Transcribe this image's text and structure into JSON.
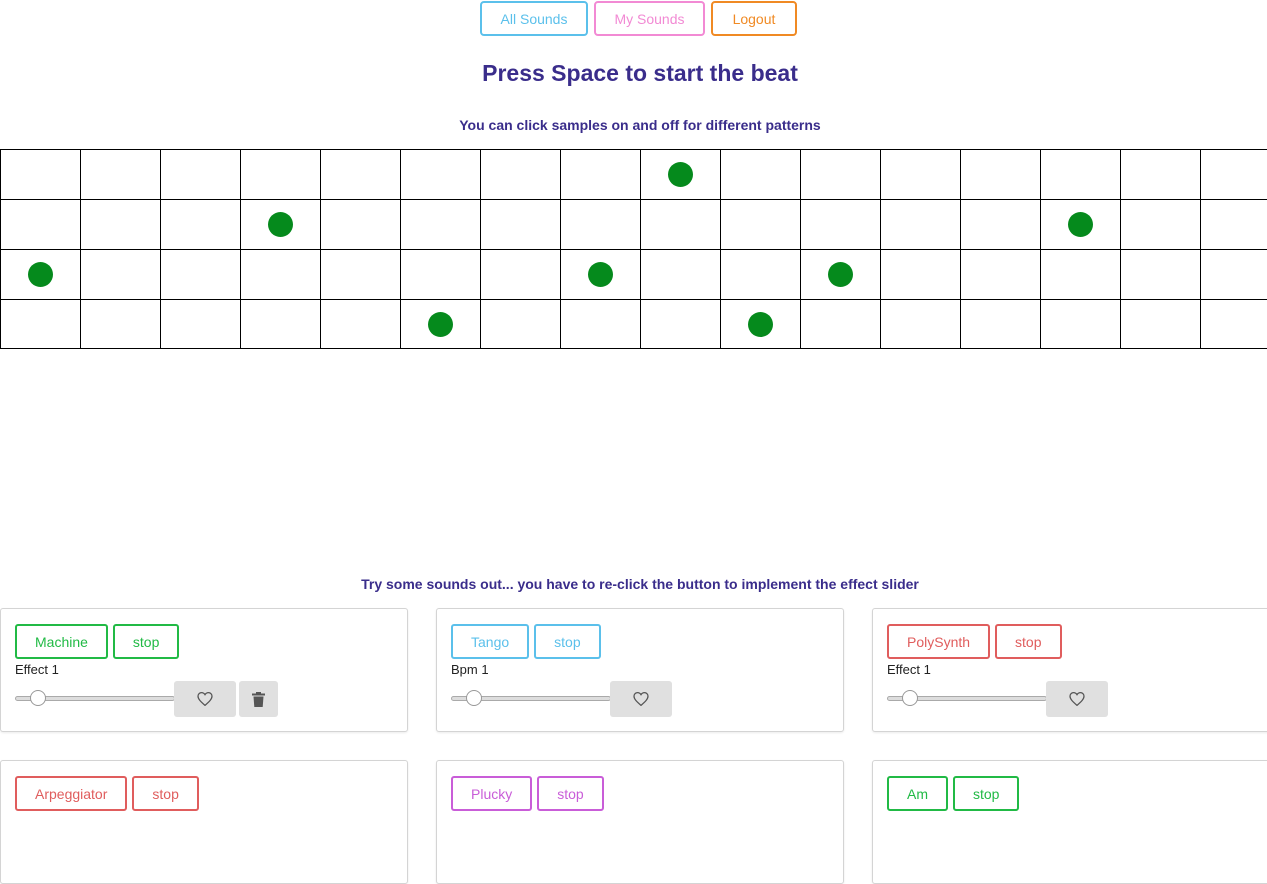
{
  "nav": {
    "all_sounds": "All Sounds",
    "my_sounds": "My Sounds",
    "logout": "Logout"
  },
  "title": "Press Space to start the beat",
  "subtitle": "You can click samples on and off for different patterns",
  "grid": {
    "active": [
      [
        8
      ],
      [
        3,
        13
      ],
      [
        0,
        7,
        10
      ],
      [
        5,
        9
      ]
    ],
    "dot_color": "#058a1c"
  },
  "try_text": "Try some sounds out... you have to re-click the button to implement the effect slider",
  "cards": [
    {
      "name": "Machine",
      "stop": "stop",
      "label": "Effect 1",
      "color": "green",
      "icons": [
        "heart-icon",
        "trash-icon"
      ]
    },
    {
      "name": "Tango",
      "stop": "stop",
      "label": "Bpm 1",
      "color": "blue",
      "icons": [
        "heart-icon"
      ]
    },
    {
      "name": "PolySynth",
      "stop": "stop",
      "label": "Effect 1",
      "color": "red",
      "icons": [
        "heart-icon"
      ]
    },
    {
      "name": "Arpeggiator",
      "stop": "stop",
      "label": "",
      "color": "red",
      "stop_color": "red"
    },
    {
      "name": "Plucky",
      "stop": "stop",
      "label": "",
      "color": "purple"
    },
    {
      "name": "Am",
      "stop": "stop",
      "label": "",
      "color": "green"
    }
  ]
}
